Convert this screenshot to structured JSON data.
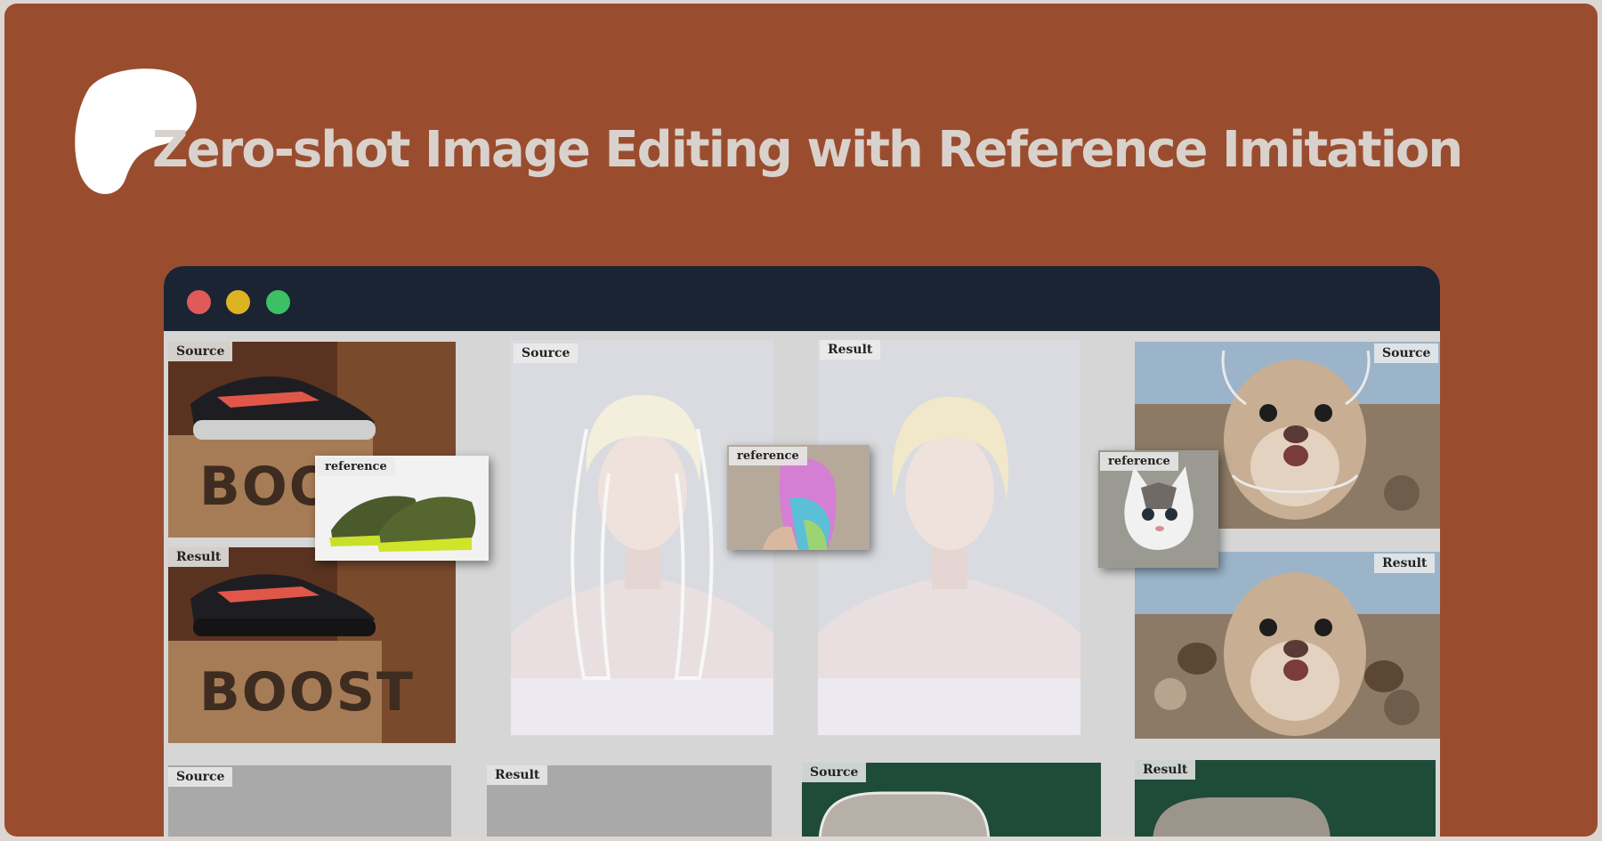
{
  "header": {
    "title": "Zero-shot Image Editing with Reference Imitation",
    "logo_icon": "brand-blob-icon"
  },
  "window": {
    "controls": [
      "close-dot",
      "minimize-dot",
      "maximize-dot"
    ]
  },
  "gallery": {
    "sneaker": {
      "source": "Source",
      "reference": "reference",
      "result": "Result",
      "box_text": "BOOST"
    },
    "portrait": {
      "source": "Source",
      "reference": "reference",
      "result": "Result"
    },
    "otter": {
      "source": "Source",
      "reference": "reference",
      "result": "Result"
    },
    "bottom_row": {
      "source_1": "Source",
      "result_1": "Result",
      "source_2": "Source",
      "result_2": "Result"
    }
  },
  "colors": {
    "background": "#9a4d2e",
    "titlebar": "#1b2433",
    "title_text": "#d9d1cc",
    "close": "#e05a5a",
    "minimize": "#ddb322",
    "maximize": "#3dbf65"
  }
}
